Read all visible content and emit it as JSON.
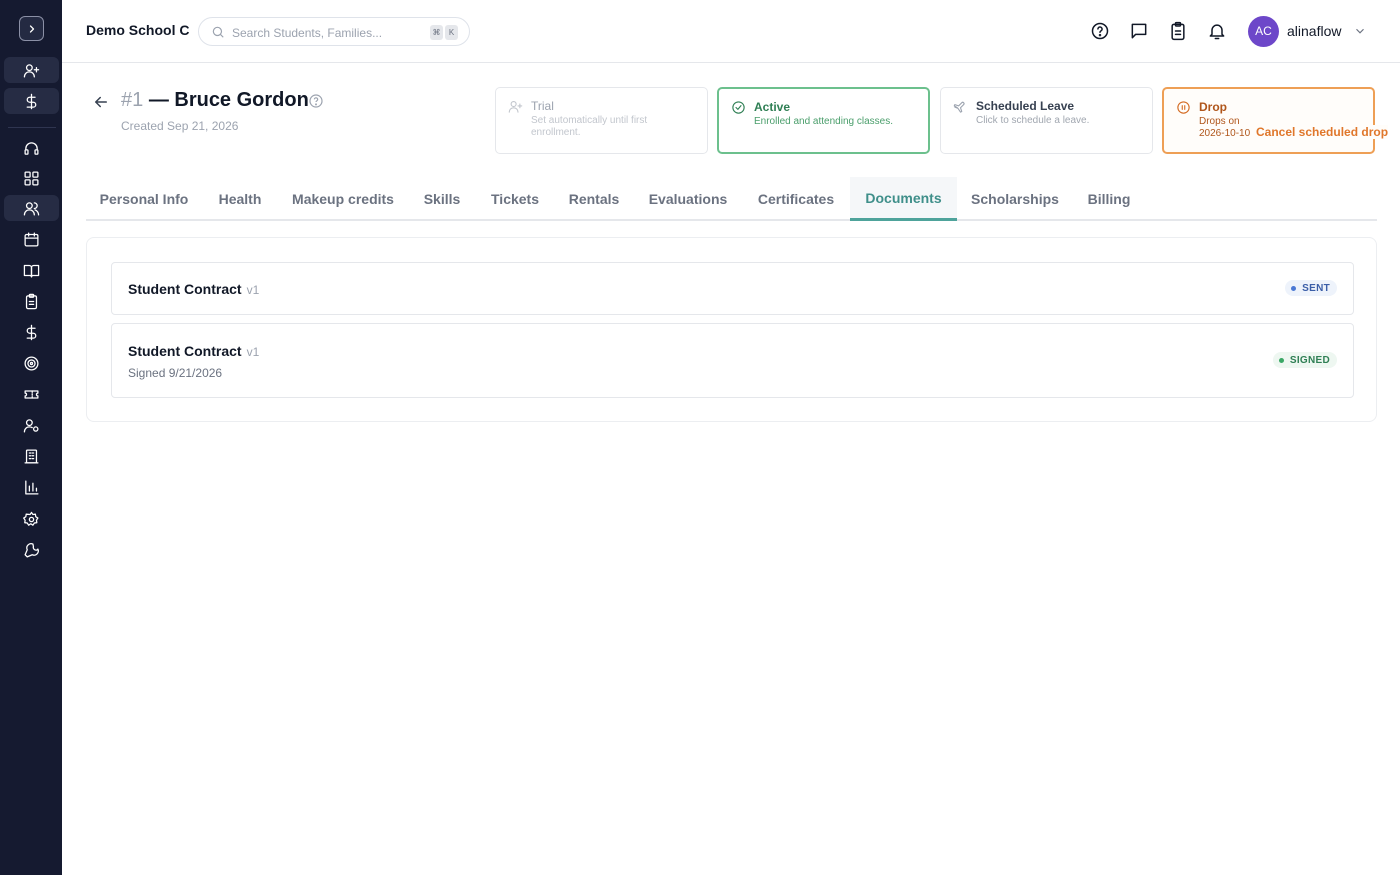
{
  "sidebar": {
    "items": [
      {
        "icon": "user-plus-icon"
      },
      {
        "icon": "dollar-icon"
      },
      {
        "icon": "headset-icon"
      },
      {
        "icon": "dashboard-grid-icon"
      },
      {
        "icon": "users-icon"
      },
      {
        "icon": "calendar-icon"
      },
      {
        "icon": "book-open-icon"
      },
      {
        "icon": "clipboard-icon"
      },
      {
        "icon": "dollar-icon"
      },
      {
        "icon": "target-icon"
      },
      {
        "icon": "ticket-icon"
      },
      {
        "icon": "user-settings-icon"
      },
      {
        "icon": "building-icon"
      },
      {
        "icon": "bar-chart-icon"
      },
      {
        "icon": "gear-icon"
      },
      {
        "icon": "wrench-icon"
      }
    ]
  },
  "header": {
    "school_name": "Demo School C",
    "search_placeholder": "Search Students, Families...",
    "shortcut_keys": [
      "⌘",
      "K"
    ],
    "user_initials": "AC",
    "username": "alinaflow"
  },
  "student": {
    "number": "#1",
    "name": "— Bruce Gordon",
    "created": "Created Sep 21, 2026"
  },
  "statuses": {
    "trial": {
      "label": "Trial",
      "desc": "Set automatically until first enrollment."
    },
    "active": {
      "label": "Active",
      "desc": "Enrolled and attending classes."
    },
    "leave": {
      "label": "Scheduled Leave",
      "desc": "Click to schedule a leave."
    },
    "drop": {
      "label": "Drop",
      "desc": "Drops on 2026-10-10",
      "action": "Cancel scheduled drop"
    }
  },
  "tabs": [
    "Personal Info",
    "Health",
    "Makeup credits",
    "Skills",
    "Tickets",
    "Rentals",
    "Evaluations",
    "Certificates",
    "Documents",
    "Scholarships",
    "Billing"
  ],
  "active_tab": "Documents",
  "documents": [
    {
      "name": "Student Contract",
      "version": "v1",
      "signed": "",
      "status": "SENT"
    },
    {
      "name": "Student Contract",
      "version": "v1",
      "signed": "Signed 9/21/2026",
      "status": "SIGNED"
    }
  ],
  "colors": {
    "sidebar_bg": "#151a30",
    "accent_teal": "#4ea39b",
    "active_green": "#6cc08d",
    "drop_orange": "#ee9f55",
    "avatar_purple": "#6d47c9"
  }
}
